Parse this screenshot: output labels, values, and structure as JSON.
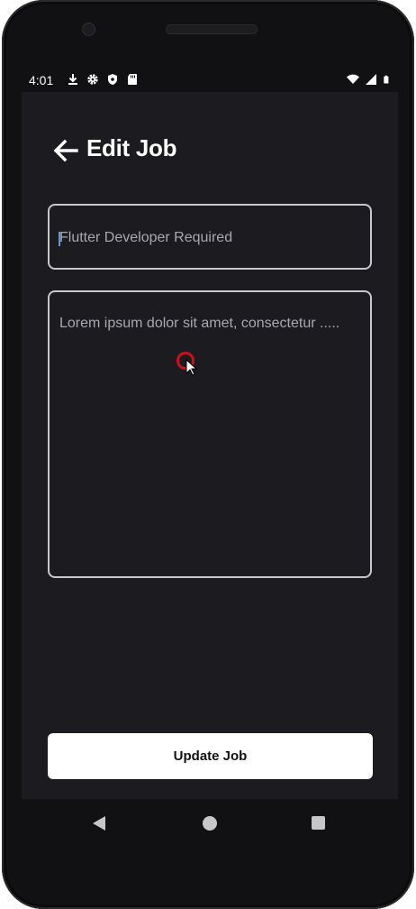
{
  "status_bar": {
    "time": "4:01",
    "left_icons": [
      "download-icon",
      "gear-icon",
      "shield-icon",
      "sd-card-icon"
    ],
    "right_icons": [
      "wifi-icon",
      "signal-icon",
      "battery-icon"
    ]
  },
  "header": {
    "title": "Edit Job",
    "back_icon": "arrow-left-icon"
  },
  "form": {
    "title_value": "Flutter Developer Required",
    "description_value": "Lorem ipsum dolor sit amet, consectetur ....."
  },
  "actions": {
    "update_label": "Update Job"
  },
  "nav_bar": {
    "icons": [
      "nav-back-icon",
      "nav-home-icon",
      "nav-recents-icon"
    ]
  },
  "colors": {
    "screen_bg": "#1c1b20",
    "field_border": "#c8c6cf",
    "caret": "#5a9bdd",
    "button_bg": "#ffffff"
  }
}
